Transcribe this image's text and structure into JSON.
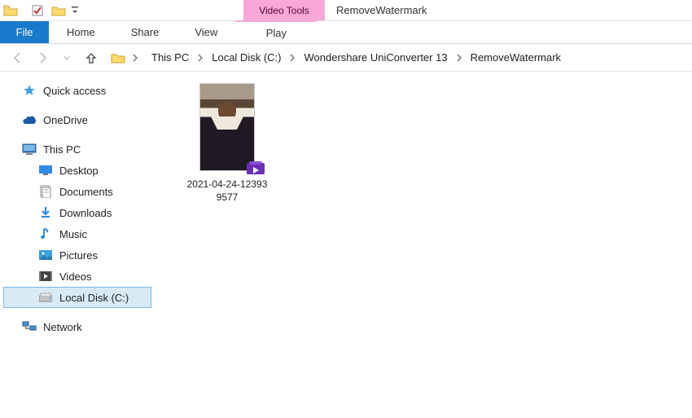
{
  "window": {
    "contextual_tab": "Video Tools",
    "title": "RemoveWatermark"
  },
  "ribbon": {
    "file": "File",
    "tabs": [
      "Home",
      "Share",
      "View"
    ],
    "contextual": "Play"
  },
  "breadcrumbs": [
    "This PC",
    "Local Disk (C:)",
    "Wondershare UniConverter 13",
    "RemoveWatermark"
  ],
  "sidebar": {
    "quick_access": "Quick access",
    "onedrive": "OneDrive",
    "this_pc": "This PC",
    "children": [
      "Desktop",
      "Documents",
      "Downloads",
      "Music",
      "Pictures",
      "Videos",
      "Local Disk (C:)"
    ],
    "network": "Network"
  },
  "files": [
    {
      "name_line1": "2021-04-24-12393",
      "name_line2": "9577"
    }
  ],
  "colors": {
    "accent": "#1979ca",
    "contextual": "#f7a8d8",
    "selection": "#d9eaf7"
  }
}
